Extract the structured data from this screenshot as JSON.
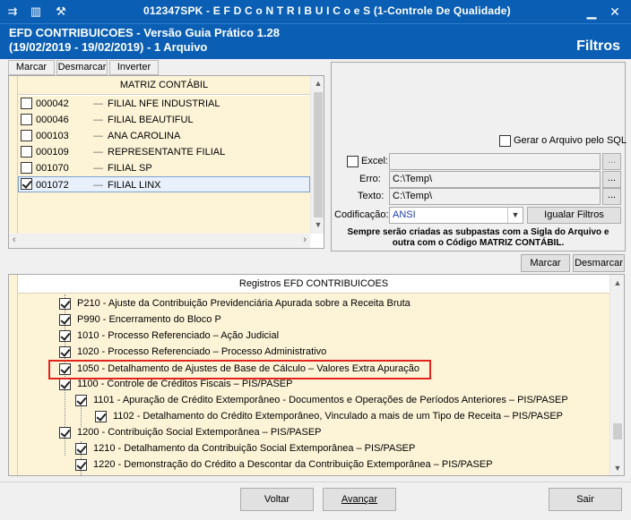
{
  "window": {
    "title": "012347SPK - E F D  C o N T R I B U I C o e S (1-Controle De Qualidade)"
  },
  "header": {
    "line1": "EFD CONTRIBUICOES - Versão Guia Prático 1.28",
    "line2": " (19/02/2019 - 19/02/2019) - 1 Arquivo",
    "section": "Filtros"
  },
  "matriz": {
    "tabs": [
      "Marcar",
      "Desmarcar",
      "Inverter"
    ],
    "column_header": "MATRIZ CONTÁBIL",
    "rows": [
      {
        "code": "000042",
        "name": "FILIAL NFE INDUSTRIAL",
        "checked": false
      },
      {
        "code": "000046",
        "name": "FILIAL BEAUTIFUL",
        "checked": false
      },
      {
        "code": "000103",
        "name": "ANA CAROLINA",
        "checked": false
      },
      {
        "code": "000109",
        "name": "REPRESENTANTE FILIAL",
        "checked": false
      },
      {
        "code": "001070",
        "name": "FILIAL SP",
        "checked": false
      },
      {
        "code": "001072",
        "name": "FILIAL LINX",
        "checked": true
      }
    ]
  },
  "filters": {
    "gerar_sql_label": "Gerar o Arquivo pelo SQL",
    "excel_label": "Excel:",
    "erro_label": "Erro:",
    "erro_value": "C:\\Temp\\",
    "texto_label": "Texto:",
    "texto_value": "C:\\Temp\\",
    "codificacao_label": "Codificação:",
    "codificacao_value": "ANSI",
    "igualar_label": "Igualar Filtros",
    "browse_label": "...",
    "note_line1": "Sempre serão criadas as subpastas com a Sigla do Arquivo e",
    "note_line2": "outra com o Código MATRIZ CONTÁBIL."
  },
  "registros_buttons": {
    "marcar": "Marcar",
    "desmarcar": "Desmarcar"
  },
  "registros": {
    "column_header": "Registros EFD CONTRIBUICOES",
    "rows": [
      {
        "text": "P210 - Ajuste da Contribuição Previdenciária Apurada sobre a Receita Bruta",
        "level": 0
      },
      {
        "text": "P990 - Encerramento do Bloco P",
        "level": 0
      },
      {
        "text": "1010 - Processo Referenciado – Ação Judicial",
        "level": 0
      },
      {
        "text": "1020 - Processo Referenciado – Processo Administrativo",
        "level": 0
      },
      {
        "text": "1050 - Detalhamento de Ajustes de Base de Cálculo – Valores Extra Apuração",
        "level": 0
      },
      {
        "text": "1100 - Controle de Créditos Fiscais – PIS/PASEP",
        "level": 0
      },
      {
        "text": "1101 - Apuração de Crédito Extemporâneo - Documentos e Operações de Períodos Anteriores – PIS/PASEP",
        "level": 1
      },
      {
        "text": "1102 - Detalhamento do Crédito Extemporâneo, Vinculado a mais de um Tipo de Receita – PIS/PASEP",
        "level": 2
      },
      {
        "text": "1200 - Contribuição Social Extemporânea – PIS/PASEP",
        "level": 0
      },
      {
        "text": "1210 - Detalhamento da Contribuição Social Extemporânea – PIS/PASEP",
        "level": 1
      },
      {
        "text": "1220 - Demonstração do Crédito a Descontar da Contribuição Extemporânea – PIS/PASEP",
        "level": 1
      }
    ]
  },
  "footer": {
    "voltar": "Voltar",
    "avancar": "Avançar",
    "sair": "Sair"
  },
  "colors": {
    "titlebar": "#0a5fb4",
    "grid_bg": "#fdf4d8",
    "highlight": "#e3241d"
  }
}
